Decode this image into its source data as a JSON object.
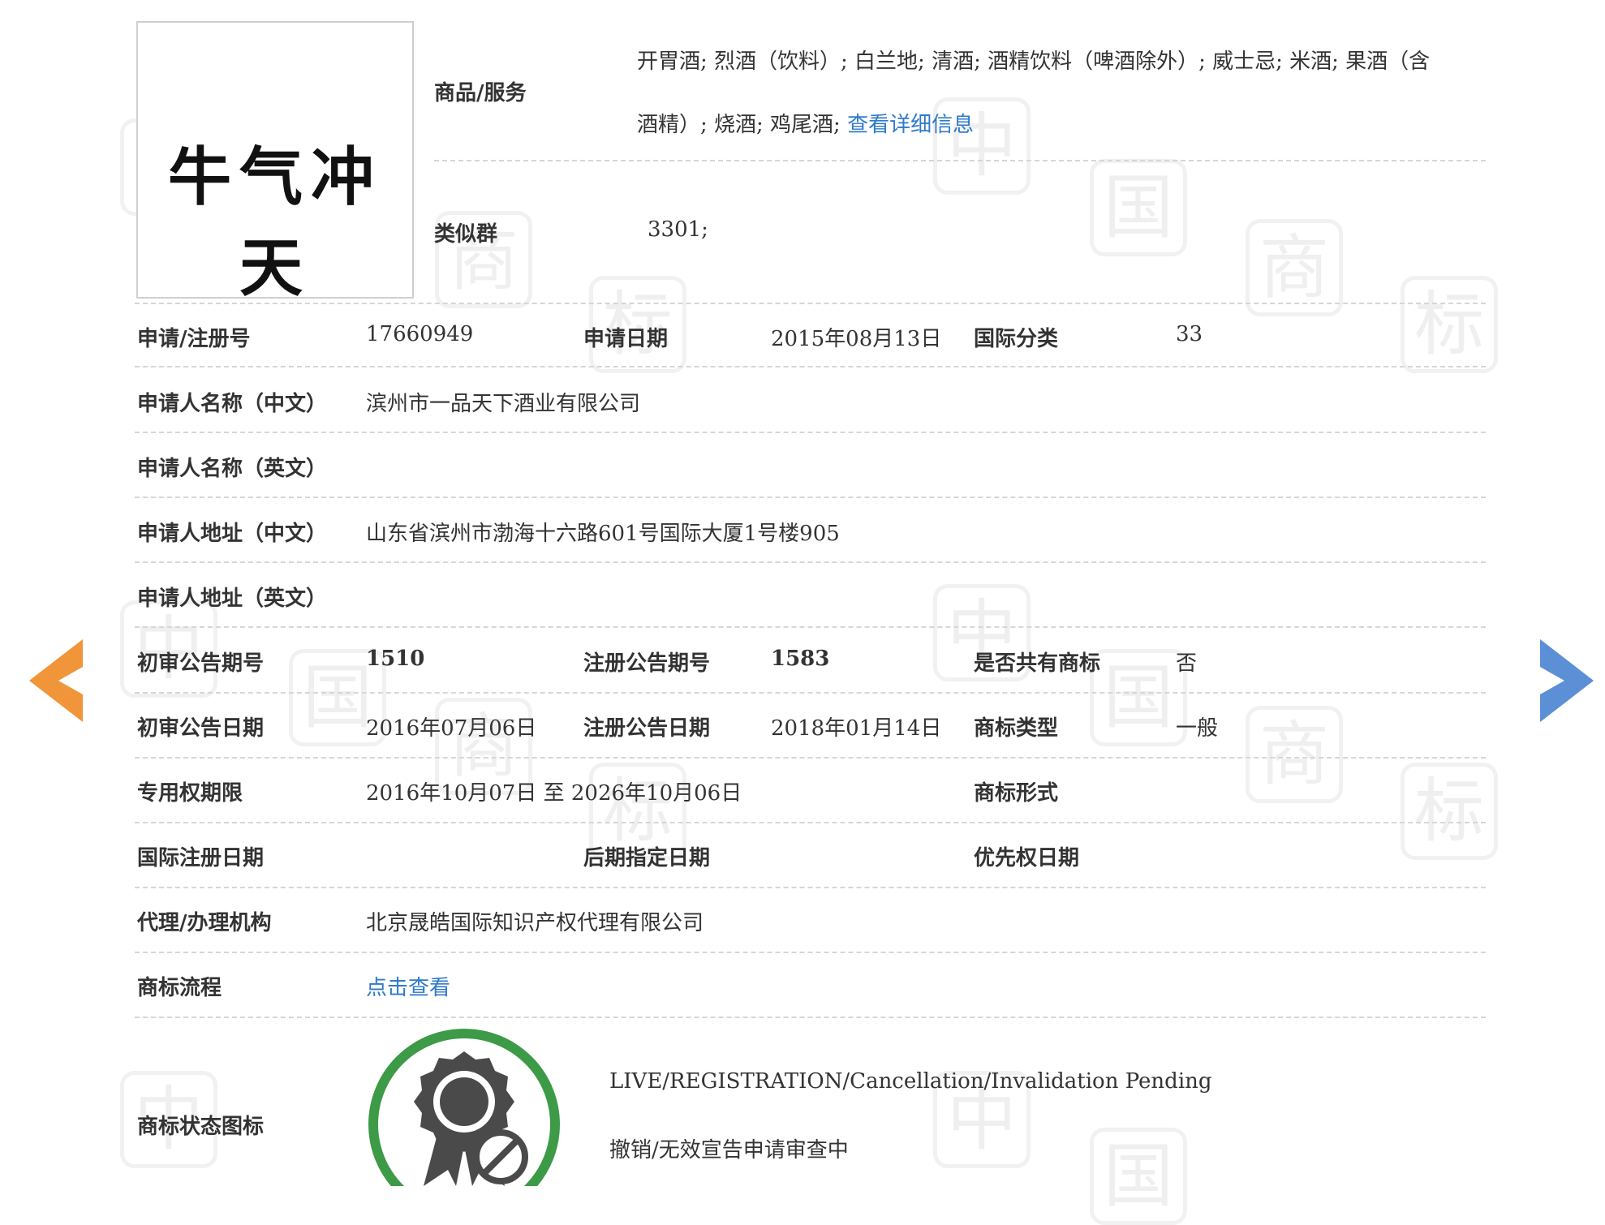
{
  "trademark": {
    "mark_text": "牛气冲天"
  },
  "goods": {
    "label": "商品/服务",
    "line1": "开胃酒; 烈酒（饮料）; 白兰地; 清酒; 酒精饮料（啤酒除外）; 威士忌; 米酒; 果酒（含",
    "line2": "酒精）; 烧酒; 鸡尾酒;",
    "detail_link": "查看详细信息"
  },
  "similar_group": {
    "label": "类似群",
    "value": "3301;"
  },
  "fields": {
    "reg_no_label": "申请/注册号",
    "reg_no": "17660949",
    "app_date_label": "申请日期",
    "app_date": "2015年08月13日",
    "intl_class_label": "国际分类",
    "intl_class": "33",
    "applicant_cn_label": "申请人名称（中文）",
    "applicant_cn": "滨州市一品天下酒业有限公司",
    "applicant_en_label": "申请人名称（英文）",
    "applicant_en": "",
    "address_cn_label": "申请人地址（中文）",
    "address_cn": "山东省滨州市渤海十六路601号国际大厦1号楼905",
    "address_en_label": "申请人地址（英文）",
    "address_en": "",
    "prelim_no_label": "初审公告期号",
    "prelim_no": "1510",
    "reg_pub_no_label": "注册公告期号",
    "reg_pub_no": "1583",
    "shared_label": "是否共有商标",
    "shared": "否",
    "prelim_date_label": "初审公告日期",
    "prelim_date": "2016年07月06日",
    "reg_pub_date_label": "注册公告日期",
    "reg_pub_date": "2018年01月14日",
    "mark_type_label": "商标类型",
    "mark_type": "一般",
    "exclusive_label": "专用权期限",
    "exclusive": "2016年10月07日 至 2026年10月06日",
    "mark_form_label": "商标形式",
    "mark_form": "",
    "intl_reg_date_label": "国际注册日期",
    "intl_reg_date": "",
    "later_date_label": "后期指定日期",
    "later_date": "",
    "priority_date_label": "优先权日期",
    "priority_date": "",
    "agent_label": "代理/办理机构",
    "agent": "北京晟皓国际知识产权代理有限公司",
    "process_label": "商标流程",
    "process_link": "点击查看",
    "status_icon_label": "商标状态图标",
    "status_en": "LIVE/REGISTRATION/Cancellation/Invalidation Pending",
    "status_cn": "撤销/无效宣告申请审查中"
  },
  "watermark": {
    "chars": [
      "中",
      "国",
      "商",
      "标"
    ]
  },
  "colors": {
    "link": "#2f7ac9",
    "prev_arrow": "#f0953a",
    "next_arrow": "#5b8fd6",
    "status_ring": "#3d9a46"
  },
  "icons": {
    "prev": "left-arrow-icon",
    "next": "right-arrow-icon",
    "status": "status-badge-icon"
  }
}
